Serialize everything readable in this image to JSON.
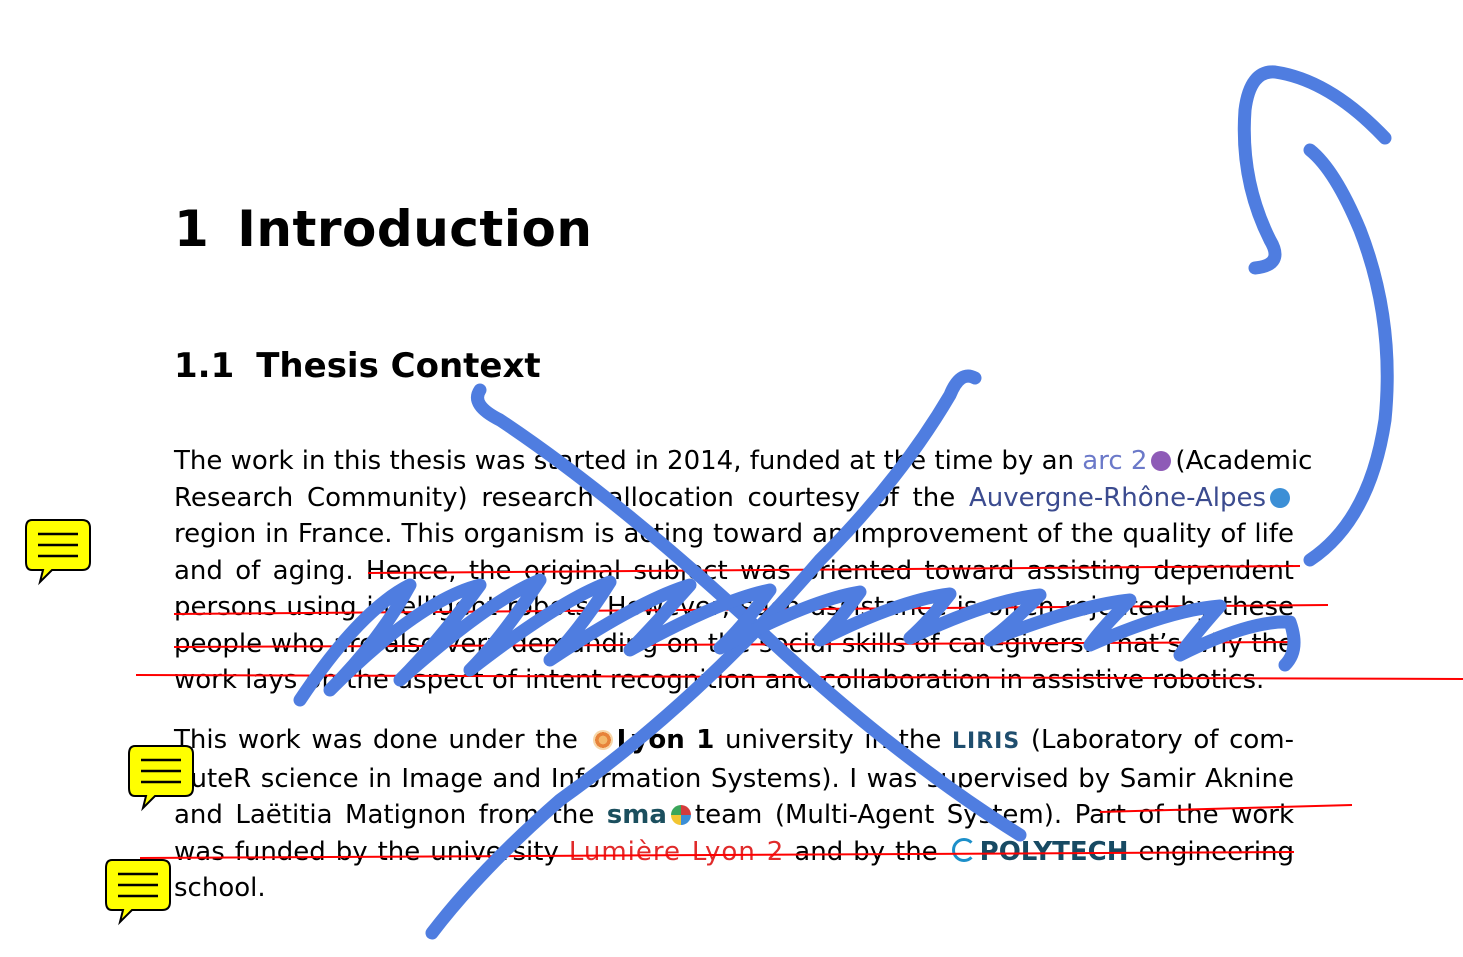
{
  "section": {
    "number": "1",
    "title": "Introduction"
  },
  "subsection": {
    "number": "1.1",
    "title": "Thesis Context"
  },
  "paragraph1": {
    "l1a": "The work in this thesis was started in 2014, funded at the time by an",
    "l1_logo": "arc 2",
    "l1b": "(Academic",
    "l2a": "Research Community) research allocation courtesy of the",
    "l2_logo": "Auvergne-Rhône-Alpes",
    "l3": "region in France. This organism is acting toward an improvement of the quality of life",
    "l4": "and of aging. Hence, the original subject was oriented toward assisting dependent",
    "l5": "persons using intelligent robots. However, such assistance is often rejected by these",
    "l6": "people who are also very demanding on the social skills of caregivers. That’s why the",
    "l7": "work lays on the aspect of intent recognition and collaboration in assistive robotics."
  },
  "paragraph2": {
    "l1a": "This work was done under the",
    "l1_logo": "Lyon 1",
    "l1b": "university in the",
    "l1_logo2": "LIRIS",
    "l1c": "(Laboratory of com-",
    "l2": "puteR science in Image and Information Systems). I was supervised by Samir Aknine",
    "l3a": "and Laëtitia Matignon from the",
    "l3_logo": "sma",
    "l3b": "team (Multi-Agent System). Part of the work",
    "l4a": "was funded by the university",
    "l4_logo": "Lumière Lyon 2",
    "l4b": "and by the",
    "l4_logo2": "POLYTECH",
    "l4c": "engineering",
    "l5": "school."
  },
  "annotations": {
    "comment_icon_color": "#ffff00",
    "ink_color": "#4f7de0",
    "strike_color": "#ff0000",
    "comments": [
      "comment-icon",
      "comment-icon",
      "comment-icon"
    ]
  }
}
